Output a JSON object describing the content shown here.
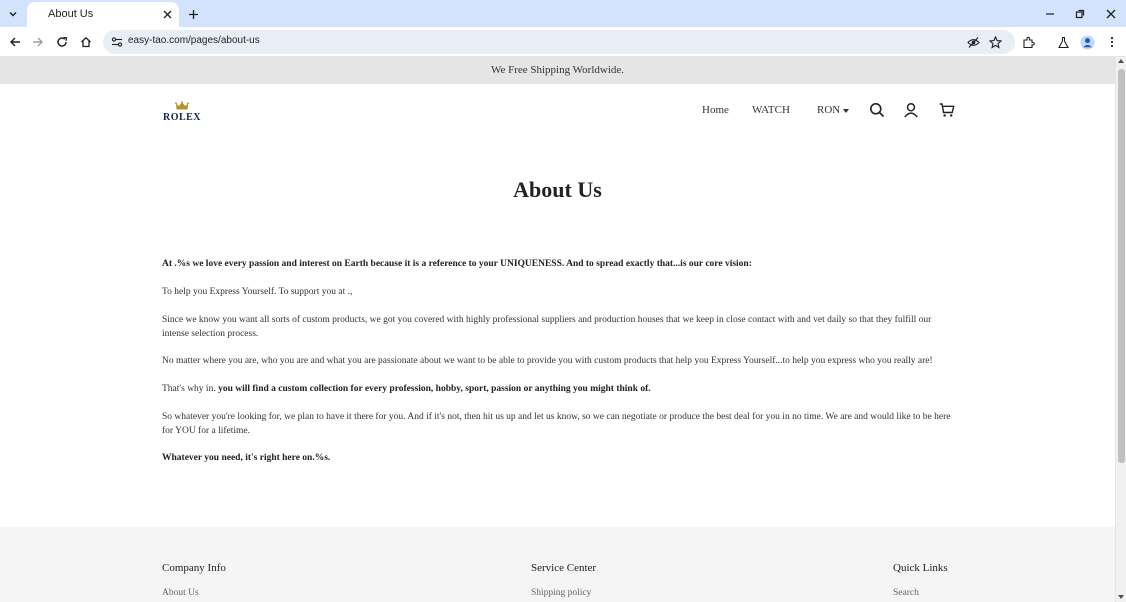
{
  "browser": {
    "tab_title": "About Us",
    "url": "easy-tao.com/pages/about-us"
  },
  "announcement": "We Free Shipping Worldwide.",
  "header": {
    "logo_text": "ROLEX",
    "nav": [
      "Home",
      "WATCH"
    ],
    "currency": "RON"
  },
  "page": {
    "title": "About Us",
    "paragraphs": [
      "At .%s we love every passion and interest on Earth because it is a reference to your UNIQUENESS. And to spread exactly that...is our core vision:",
      "To help you Express Yourself. To support you at .,",
      "Since we know you want all sorts of custom products, we got you covered with highly professional suppliers and production houses that we keep in close contact with and vet daily so that they fulfill our intense selection process.",
      "No matter where you are, who you are and what you are passionate about we want to be able to provide you with custom products that help you Express Yourself...to help you express who you really are!",
      "So whatever you're looking for, we plan to have it there for you. And if it's not, then hit us up and let us know, so we can negotiate or produce the best deal for you in no time. We are and would like to be here for YOU for a lifetime.",
      "Whatever you need, it's right here on.%s."
    ],
    "why_prefix": "That's why in. ",
    "why_bold": "you will find a custom collection for every profession, hobby, sport, passion or anything you might think of."
  },
  "footer": {
    "columns": [
      {
        "heading": "Company Info",
        "first_link": "About Us"
      },
      {
        "heading": "Service Center",
        "first_link": "Shipping policy"
      },
      {
        "heading": "Quick Links",
        "first_link": "Search"
      }
    ]
  },
  "colors": {
    "tabstrip": "#d3e3fd",
    "omnibox": "#e9eef6",
    "announcement_bg": "#e5e5e5",
    "footer_bg": "#f5f5f5",
    "logo": "#13264a"
  }
}
